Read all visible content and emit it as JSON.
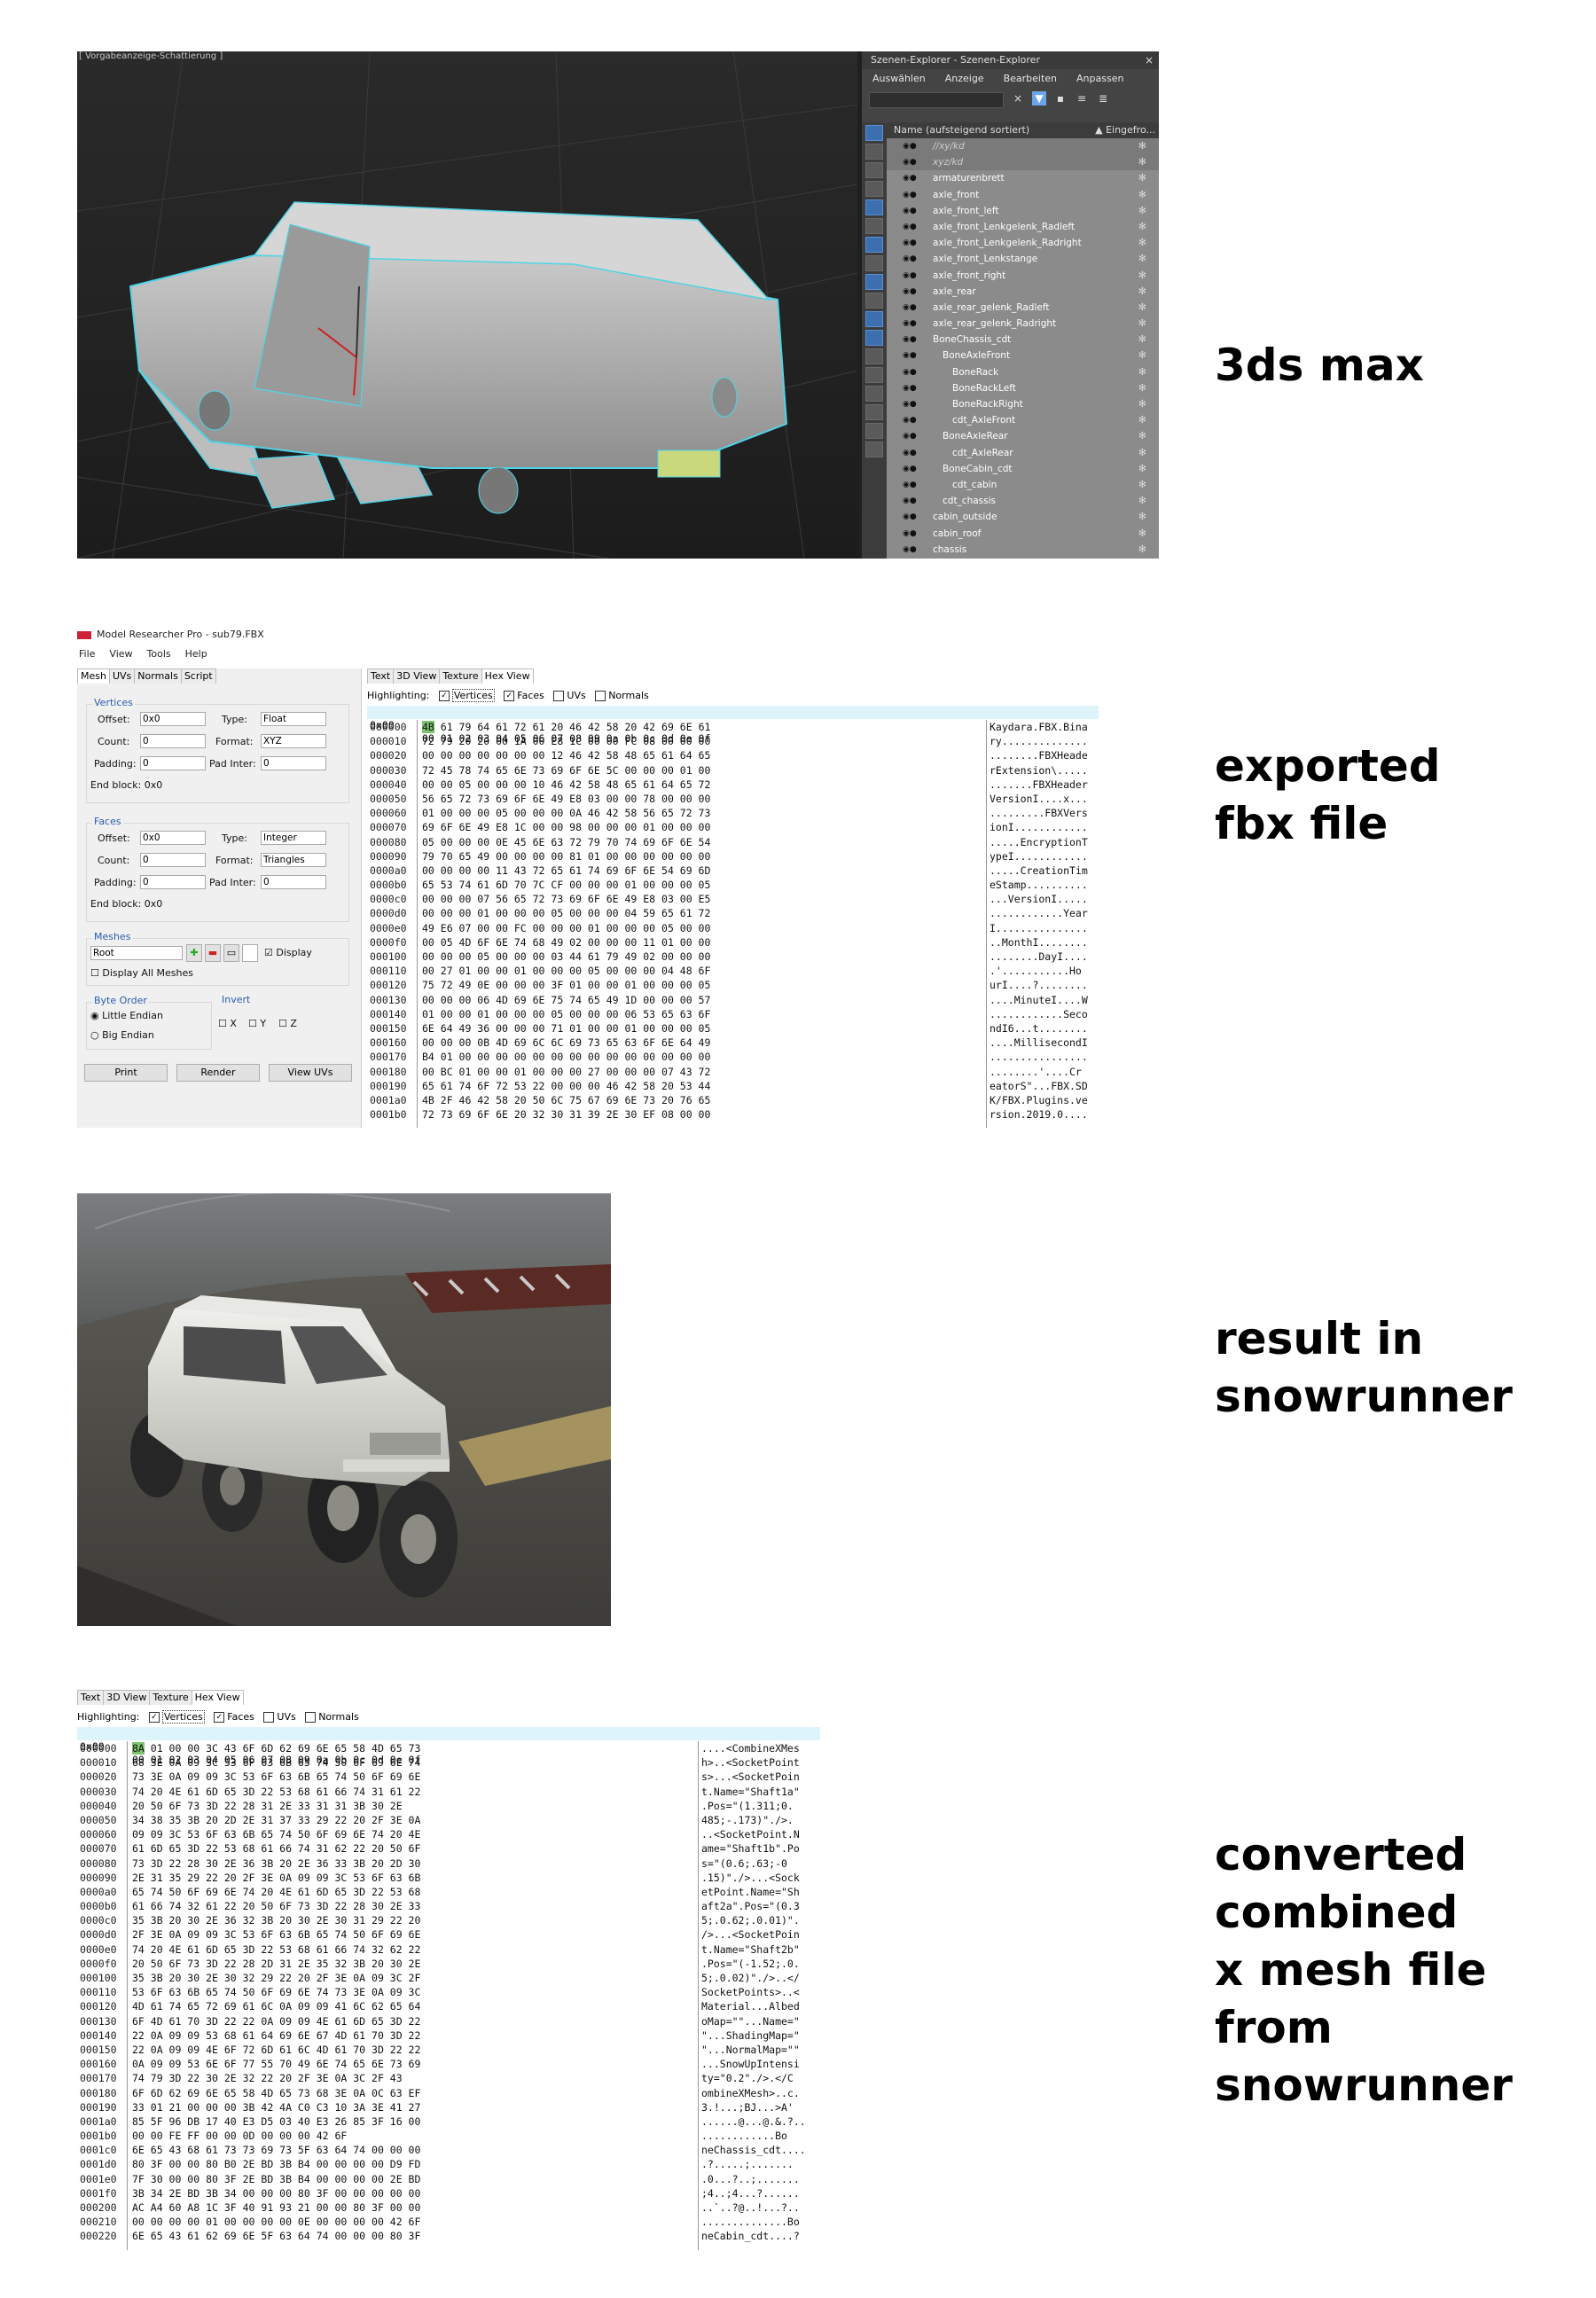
{
  "captions": {
    "max": [
      "3ds max"
    ],
    "fbx": [
      "exported",
      "fbx file"
    ],
    "result": [
      "result in",
      "snowrunner"
    ],
    "converted": [
      "converted",
      "combined",
      "x mesh file",
      "from",
      "snowrunner"
    ]
  },
  "max3ds": {
    "viewport_label": "[ Vorgabeanzeige-Schattierung ]",
    "explorer": {
      "title": "Szenen-Explorer - Szenen-Explorer",
      "close": "×",
      "menu": [
        "Auswählen",
        "Anzeige",
        "Bearbeiten",
        "Anpassen"
      ],
      "header_name": "Name (aufsteigend sortiert)",
      "header_frozen": "▲ Eingefro...",
      "rows": [
        {
          "name": "//xy/kd",
          "indent": 0,
          "dim": true
        },
        {
          "name": "xyz/kd",
          "indent": 0,
          "dim": true
        },
        {
          "name": "armaturenbrett",
          "indent": 0
        },
        {
          "name": "axle_front",
          "indent": 0
        },
        {
          "name": "axle_front_left",
          "indent": 0
        },
        {
          "name": "axle_front_Lenkgelenk_Radleft",
          "indent": 0
        },
        {
          "name": "axle_front_Lenkgelenk_Radright",
          "indent": 0
        },
        {
          "name": "axle_front_Lenkstange",
          "indent": 0
        },
        {
          "name": "axle_front_right",
          "indent": 0
        },
        {
          "name": "axle_rear",
          "indent": 0
        },
        {
          "name": "axle_rear_gelenk_Radleft",
          "indent": 0
        },
        {
          "name": "axle_rear_gelenk_Radright",
          "indent": 0
        },
        {
          "name": "BoneChassis_cdt",
          "indent": 0
        },
        {
          "name": "BoneAxleFront",
          "indent": 1
        },
        {
          "name": "BoneRack",
          "indent": 2
        },
        {
          "name": "BoneRackLeft",
          "indent": 2
        },
        {
          "name": "BoneRackRight",
          "indent": 2
        },
        {
          "name": "cdt_AxleFront",
          "indent": 2
        },
        {
          "name": "BoneAxleRear",
          "indent": 1
        },
        {
          "name": "cdt_AxleRear",
          "indent": 2
        },
        {
          "name": "BoneCabin_cdt",
          "indent": 1
        },
        {
          "name": "cdt_cabin",
          "indent": 2
        },
        {
          "name": "cdt_chassis",
          "indent": 1
        },
        {
          "name": "cabin_outside",
          "indent": 0
        },
        {
          "name": "cabin_roof",
          "indent": 0
        },
        {
          "name": "chassis",
          "indent": 0
        }
      ]
    }
  },
  "fbx": {
    "window_title": "Model Researcher Pro - sub79.FBX",
    "menu": [
      "File",
      "View",
      "Tools",
      "Help"
    ],
    "left_tabs": [
      "Mesh",
      "UVs",
      "Normals",
      "Script"
    ],
    "vertices": {
      "title": "Vertices",
      "offset_label": "Offset:",
      "offset": "0x0",
      "count_label": "Count:",
      "count": "0",
      "padding_label": "Padding:",
      "padding": "0",
      "type_label": "Type:",
      "type": "Float",
      "format_label": "Format:",
      "format": "XYZ",
      "padinter_label": "Pad Inter:",
      "padinter": "0",
      "endblock": "End block: 0x0"
    },
    "faces": {
      "title": "Faces",
      "offset_label": "Offset:",
      "offset": "0x0",
      "count_label": "Count:",
      "count": "0",
      "padding_label": "Padding:",
      "padding": "0",
      "type_label": "Type:",
      "type": "Integer",
      "format_label": "Format:",
      "format": "Triangles",
      "padinter_label": "Pad Inter:",
      "padinter": "0",
      "endblock": "End block: 0x0"
    },
    "meshes": {
      "title": "Meshes",
      "selected": "Root",
      "display": "Display",
      "display_all": "Display All Meshes"
    },
    "byte_order": {
      "title": "Byte Order",
      "little": "Little Endian",
      "big": "Big Endian"
    },
    "invert": {
      "title": "Invert",
      "x": "X",
      "y": "Y",
      "z": "Z"
    },
    "buttons": [
      "Print",
      "Render",
      "View UVs"
    ],
    "hex_tabs": [
      "Text",
      "3D View",
      "Texture",
      "Hex View"
    ],
    "highlighting": {
      "label": "Highlighting:",
      "items": [
        "Vertices",
        "Faces",
        "UVs",
        "Normals"
      ],
      "checked": [
        true,
        true,
        false,
        false
      ]
    },
    "offset_header": "0x00",
    "col_header": "00 01 02 03 04 05 06 07 08 09 0a 0b 0c 0d 0e 0f",
    "rows": [
      {
        "off": "000000",
        "bytes": "4B 61 79 64 61 72 61 20 46 42 58 20 42 69 6E 61",
        "ascii": "Kaydara.FBX.Bina"
      },
      {
        "off": "000010",
        "bytes": "72 79 20 20 00 1A 00 E8 1C 00 00 FC 08 00 00 00",
        "ascii": "ry.............."
      },
      {
        "off": "000020",
        "bytes": "00 00 00 00 00 00 00 12 46 42 58 48 65 61 64 65",
        "ascii": "........FBXHeade"
      },
      {
        "off": "000030",
        "bytes": "72 45 78 74 65 6E 73 69 6F 6E 5C 00 00 00 01 00",
        "ascii": "rExtension\\....."
      },
      {
        "off": "000040",
        "bytes": "00 00 05 00 00 00 10 46 42 58 48 65 61 64 65 72",
        "ascii": ".......FBXHeader"
      },
      {
        "off": "000050",
        "bytes": "56 65 72 73 69 6F 6E 49 E8 03 00 00 78 00 00 00",
        "ascii": "VersionI....x..."
      },
      {
        "off": "000060",
        "bytes": "01 00 00 00 05 00 00 00 0A 46 42 58 56 65 72 73",
        "ascii": ".........FBXVers"
      },
      {
        "off": "000070",
        "bytes": "69 6F 6E 49 E8 1C 00 00 98 00 00 00 01 00 00 00",
        "ascii": "ionI............"
      },
      {
        "off": "000080",
        "bytes": "05 00 00 00 0E 45 6E 63 72 79 70 74 69 6F 6E 54",
        "ascii": ".....EncryptionT"
      },
      {
        "off": "000090",
        "bytes": "79 70 65 49 00 00 00 00 81 01 00 00 00 00 00 00",
        "ascii": "ypeI............"
      },
      {
        "off": "0000a0",
        "bytes": "00 00 00 00 11 43 72 65 61 74 69 6F 6E 54 69 6D",
        "ascii": ".....CreationTim"
      },
      {
        "off": "0000b0",
        "bytes": "65 53 74 61 6D 70 7C CF 00 00 00 01 00 00 00 05",
        "ascii": "eStamp.........."
      },
      {
        "off": "0000c0",
        "bytes": "00 00 00 07 56 65 72 73 69 6F 6E 49 E8 03 00 E5",
        "ascii": "...VersionI....."
      },
      {
        "off": "0000d0",
        "bytes": "00 00 00 01 00 00 00 05 00 00 00 04 59 65 61 72",
        "ascii": "............Year"
      },
      {
        "off": "0000e0",
        "bytes": "49 E6 07 00 00 FC 00 00 00 01 00 00 00 05 00 00",
        "ascii": "I..............."
      },
      {
        "off": "0000f0",
        "bytes": "00 05 4D 6F 6E 74 68 49 02 00 00 00 11 01 00 00",
        "ascii": "..MonthI........"
      },
      {
        "off": "000100",
        "bytes": "00 00 00 05 00 00 00 03 44 61 79 49 02 00 00 00",
        "ascii": "........DayI...."
      },
      {
        "off": "000110",
        "bytes": "00 27 01 00 00 01 00 00 00 05 00 00 00 04 48 6F",
        "ascii": ".'...........Ho"
      },
      {
        "off": "000120",
        "bytes": "75 72 49 0E 00 00 00 3F 01 00 00 01 00 00 00 05",
        "ascii": "urI....?........"
      },
      {
        "off": "000130",
        "bytes": "00 00 00 06 4D 69 6E 75 74 65 49 1D 00 00 00 57",
        "ascii": "....MinuteI....W"
      },
      {
        "off": "000140",
        "bytes": "01 00 00 01 00 00 00 05 00 00 00 06 53 65 63 6F",
        "ascii": "............Seco"
      },
      {
        "off": "000150",
        "bytes": "6E 64 49 36 00 00 00 71 01 00 00 01 00 00 00 05",
        "ascii": "ndI6...t........"
      },
      {
        "off": "000160",
        "bytes": "00 00 00 0B 4D 69 6C 6C 69 73 65 63 6F 6E 64 49",
        "ascii": "....MillisecondI"
      },
      {
        "off": "000170",
        "bytes": "B4 01 00 00 00 00 00 00 00 00 00 00 00 00 00 00",
        "ascii": "................"
      },
      {
        "off": "000180",
        "bytes": "00 BC 01 00 00 01 00 00 00 27 00 00 00 07 43 72",
        "ascii": "........'....Cr"
      },
      {
        "off": "000190",
        "bytes": "65 61 74 6F 72 53 22 00 00 00 46 42 58 20 53 44",
        "ascii": "eatorS\"...FBX.SD"
      },
      {
        "off": "0001a0",
        "bytes": "4B 2F 46 42 58 20 50 6C 75 67 69 6E 73 20 76 65",
        "ascii": "K/FBX.Plugins.ve"
      },
      {
        "off": "0001b0",
        "bytes": "72 73 69 6F 6E 20 32 30 31 39 2E 30 EF 08 00 00",
        "ascii": "rsion.2019.0...."
      }
    ]
  },
  "xmesh": {
    "hex_tabs": [
      "Text",
      "3D View",
      "Texture",
      "Hex View"
    ],
    "highlighting": {
      "label": "Highlighting:",
      "items": [
        "Vertices",
        "Faces",
        "UVs",
        "Normals"
      ],
      "checked": [
        true,
        true,
        false,
        false
      ]
    },
    "offset_header": "0x00",
    "col_header": "00 01 02 03 04 05 06 07 08 09 0a 0b 0c 0d 0e 0f",
    "rows": [
      {
        "off": "000000",
        "bytes": "8A 01 00 00 3C 43 6F 6D 62 69 6E 65 58 4D 65 73",
        "ascii": "....<CombineXMes"
      },
      {
        "off": "000010",
        "bytes": "68 3E 0A 09 3C 53 6F 63 6B 65 74 50 6F 69 6E 74",
        "ascii": "h>..<SocketPoint"
      },
      {
        "off": "000020",
        "bytes": "73 3E 0A 09 09 3C 53 6F 63 6B 65 74 50 6F 69 6E",
        "ascii": "s>...<SocketPoin"
      },
      {
        "off": "000030",
        "bytes": "74 20 4E 61 6D 65 3D 22 53 68 61 66 74 31 61 22",
        "ascii": "t.Name=\"Shaft1a\""
      },
      {
        "off": "000040",
        "bytes": "20 50 6F 73 3D 22 28 31 2E 33 31 31 3B 30 2E",
        "ascii": ".Pos=\"(1.311;0."
      },
      {
        "off": "000050",
        "bytes": "34 38 35 3B 20 2D 2E 31 37 33 29 22 20 2F 3E 0A",
        "ascii": "485;-.173)\"./>."
      },
      {
        "off": "000060",
        "bytes": "09 09 3C 53 6F 63 6B 65 74 50 6F 69 6E 74 20 4E",
        "ascii": "..<SocketPoint.N"
      },
      {
        "off": "000070",
        "bytes": "61 6D 65 3D 22 53 68 61 66 74 31 62 22 20 50 6F",
        "ascii": "ame=\"Shaft1b\".Po"
      },
      {
        "off": "000080",
        "bytes": "73 3D 22 28 30 2E 36 3B 20 2E 36 33 3B 20 2D 30",
        "ascii": "s=\"(0.6;.63;-0"
      },
      {
        "off": "000090",
        "bytes": "2E 31 35 29 22 20 2F 3E 0A 09 09 3C 53 6F 63 6B",
        "ascii": ".15)\"./>...<Sock"
      },
      {
        "off": "0000a0",
        "bytes": "65 74 50 6F 69 6E 74 20 4E 61 6D 65 3D 22 53 68",
        "ascii": "etPoint.Name=\"Sh"
      },
      {
        "off": "0000b0",
        "bytes": "61 66 74 32 61 22 20 50 6F 73 3D 22 28 30 2E 33",
        "ascii": "aft2a\".Pos=\"(0.3"
      },
      {
        "off": "0000c0",
        "bytes": "35 3B 20 30 2E 36 32 3B 20 30 2E 30 31 29 22 20",
        "ascii": "5;.0.62;.0.01)\"."
      },
      {
        "off": "0000d0",
        "bytes": "2F 3E 0A 09 09 3C 53 6F 63 6B 65 74 50 6F 69 6E",
        "ascii": "/>...<SocketPoin"
      },
      {
        "off": "0000e0",
        "bytes": "74 20 4E 61 6D 65 3D 22 53 68 61 66 74 32 62 22",
        "ascii": "t.Name=\"Shaft2b\""
      },
      {
        "off": "0000f0",
        "bytes": "20 50 6F 73 3D 22 28 2D 31 2E 35 32 3B 20 30 2E",
        "ascii": ".Pos=\"(-1.52;.0."
      },
      {
        "off": "000100",
        "bytes": "35 3B 20 30 2E 30 32 29 22 20 2F 3E 0A 09 3C 2F",
        "ascii": "5;.0.02)\"./>..</"
      },
      {
        "off": "000110",
        "bytes": "53 6F 63 6B 65 74 50 6F 69 6E 74 73 3E 0A 09 3C",
        "ascii": "SocketPoints>..<"
      },
      {
        "off": "000120",
        "bytes": "4D 61 74 65 72 69 61 6C 0A 09 09 41 6C 62 65 64",
        "ascii": "Material...Albed"
      },
      {
        "off": "000130",
        "bytes": "6F 4D 61 70 3D 22 22 0A 09 09 4E 61 6D 65 3D 22",
        "ascii": "oMap=\"\"...Name=\""
      },
      {
        "off": "000140",
        "bytes": "22 0A 09 09 53 68 61 64 69 6E 67 4D 61 70 3D 22",
        "ascii": "\"...ShadingMap=\""
      },
      {
        "off": "000150",
        "bytes": "22 0A 09 09 4E 6F 72 6D 61 6C 4D 61 70 3D 22 22",
        "ascii": "\"...NormalMap=\"\""
      },
      {
        "off": "000160",
        "bytes": "0A 09 09 53 6E 6F 77 55 70 49 6E 74 65 6E 73 69",
        "ascii": "...SnowUpIntensi"
      },
      {
        "off": "000170",
        "bytes": "74 79 3D 22 30 2E 32 22 20 2F 3E 0A 3C 2F 43",
        "ascii": "ty=\"0.2\"./>.</C"
      },
      {
        "off": "000180",
        "bytes": "6F 6D 62 69 6E 65 58 4D 65 73 68 3E 0A 0C 63 EF",
        "ascii": "ombineXMesh>..c."
      },
      {
        "off": "000190",
        "bytes": "33 01 21 00 00 00 3B 42 4A C0 C3 10 3A 3E 41 27",
        "ascii": "3.!...;BJ...>A'"
      },
      {
        "off": "0001a0",
        "bytes": "85 5F 96 DB 17 40 E3 D5 03 40 E3 26 85 3F 16 00",
        "ascii": "......@...@.&.?.."
      },
      {
        "off": "0001b0",
        "bytes": "00 00 FE FF 00 00 0D 00 00 00 42 6F",
        "ascii": "............Bo"
      },
      {
        "off": "0001c0",
        "bytes": "6E 65 43 68 61 73 73 69 73 5F 63 64 74 00 00 00",
        "ascii": "neChassis_cdt...."
      },
      {
        "off": "0001d0",
        "bytes": "80 3F 00 00 80 B0 2E BD 3B B4 00 00 00 00 D9 FD",
        "ascii": ".?.....;......."
      },
      {
        "off": "0001e0",
        "bytes": "7F 30 00 00 80 3F 2E BD 3B B4 00 00 00 00 2E BD",
        "ascii": ".0...?..;......."
      },
      {
        "off": "0001f0",
        "bytes": "3B 34 2E BD 3B 34 00 00 00 80 3F 00 00 00 00 00",
        "ascii": ";4..;4...?......"
      },
      {
        "off": "000200",
        "bytes": "AC A4 60 A8 1C 3F 40 91 93 21 00 00 80 3F 00 00",
        "ascii": "..`..?@..!...?.."
      },
      {
        "off": "000210",
        "bytes": "00 00 00 00 01 00 00 00 00 0E 00 00 00 00 42 6F",
        "ascii": "..............Bo"
      },
      {
        "off": "000220",
        "bytes": "6E 65 43 61 62 69 6E 5F 63 64 74 00 00 00 80 3F",
        "ascii": "neCabin_cdt....?"
      }
    ]
  }
}
